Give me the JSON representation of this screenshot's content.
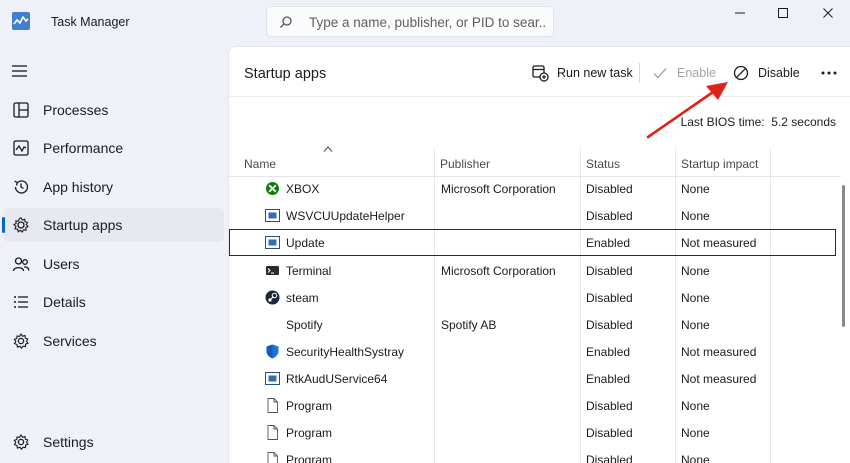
{
  "window": {
    "title": "Task Manager",
    "search_placeholder": "Type a name, publisher, or PID to sear..."
  },
  "sidebar": {
    "items": [
      {
        "label": "Processes",
        "icon": "processes-icon"
      },
      {
        "label": "Performance",
        "icon": "performance-icon"
      },
      {
        "label": "App history",
        "icon": "app-history-icon"
      },
      {
        "label": "Startup apps",
        "icon": "startup-apps-icon",
        "active": true
      },
      {
        "label": "Users",
        "icon": "users-icon"
      },
      {
        "label": "Details",
        "icon": "details-icon"
      },
      {
        "label": "Services",
        "icon": "services-icon"
      }
    ],
    "settings_label": "Settings"
  },
  "main": {
    "title": "Startup apps",
    "toolbar": {
      "run_new_task": "Run new task",
      "enable": "Enable",
      "disable": "Disable"
    },
    "bios_label": "Last BIOS time:",
    "bios_value": "5.2 seconds",
    "columns": [
      "Name",
      "Publisher",
      "Status",
      "Startup impact"
    ],
    "rows": [
      {
        "name": "XBOX",
        "publisher": "Microsoft Corporation",
        "status": "Disabled",
        "impact": "None",
        "icon": "xbox-icon"
      },
      {
        "name": "WSVCUUpdateHelper",
        "publisher": "",
        "status": "Disabled",
        "impact": "None",
        "icon": "app-window-icon"
      },
      {
        "name": "Update",
        "publisher": "",
        "status": "Enabled",
        "impact": "Not measured",
        "icon": "app-window-icon",
        "selected": true
      },
      {
        "name": "Terminal",
        "publisher": "Microsoft Corporation",
        "status": "Disabled",
        "impact": "None",
        "icon": "terminal-icon"
      },
      {
        "name": "steam",
        "publisher": "",
        "status": "Disabled",
        "impact": "None",
        "icon": "steam-icon"
      },
      {
        "name": "Spotify",
        "publisher": "Spotify AB",
        "status": "Disabled",
        "impact": "None",
        "icon": ""
      },
      {
        "name": "SecurityHealthSystray",
        "publisher": "",
        "status": "Enabled",
        "impact": "Not measured",
        "icon": "shield-icon"
      },
      {
        "name": "RtkAudUService64",
        "publisher": "",
        "status": "Enabled",
        "impact": "Not measured",
        "icon": "app-window-icon"
      },
      {
        "name": "Program",
        "publisher": "",
        "status": "Disabled",
        "impact": "None",
        "icon": "file-icon"
      },
      {
        "name": "Program",
        "publisher": "",
        "status": "Disabled",
        "impact": "None",
        "icon": "file-icon"
      },
      {
        "name": "Program",
        "publisher": "",
        "status": "Disabled",
        "impact": "None",
        "icon": "file-icon"
      }
    ]
  },
  "colors": {
    "accent": "#0067c0",
    "annotation_arrow": "#e0211b"
  }
}
